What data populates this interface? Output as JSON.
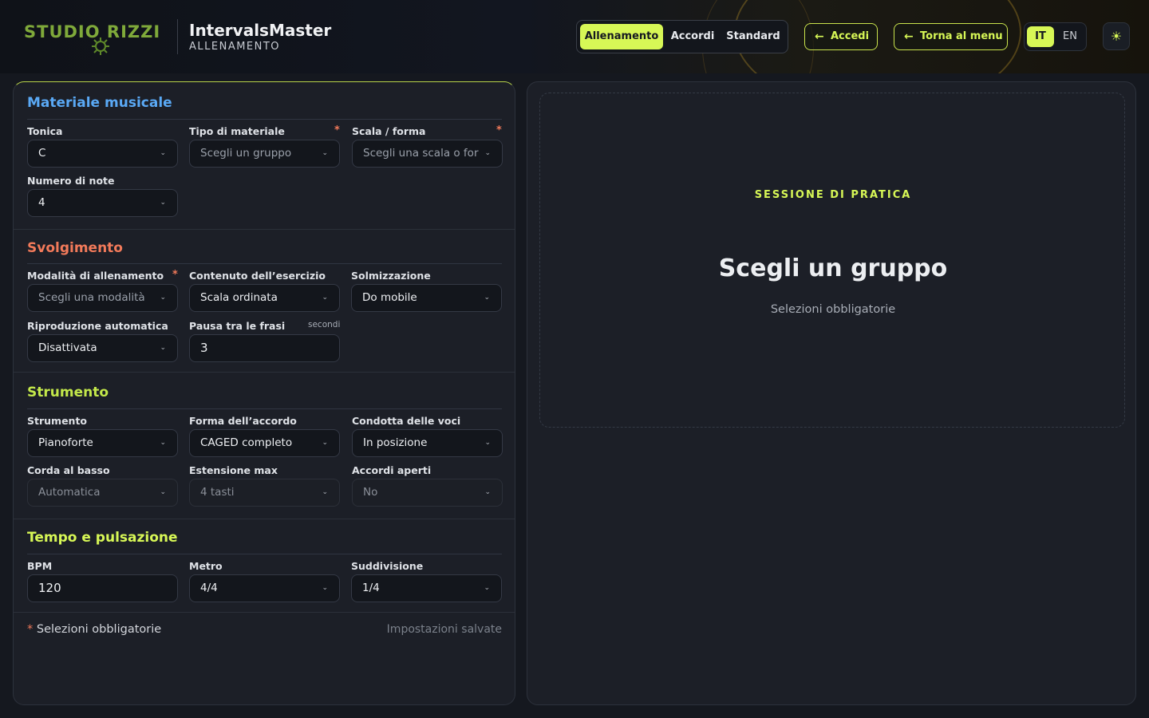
{
  "header": {
    "logo": "STUDIO RIZZI",
    "app_title": "IntervalsMaster",
    "app_subtitle": "ALLENAMENTO",
    "tabs": [
      {
        "label": "Allenamento",
        "active": true
      },
      {
        "label": "Accordi",
        "active": false
      },
      {
        "label": "Standard",
        "active": false
      }
    ],
    "login_label": "Accedi",
    "back_label": "Torna al menu",
    "languages": [
      {
        "label": "IT",
        "active": true
      },
      {
        "label": "EN",
        "active": false
      }
    ],
    "theme_icon": "sun-icon",
    "accent_color": "#d7f756"
  },
  "sections": {
    "materiale": {
      "title": "Materiale musicale",
      "color": "#5aa9f5",
      "tonica": {
        "label": "Tonica",
        "value": "C"
      },
      "tipo": {
        "label": "Tipo di materiale",
        "placeholder": "Scegli un gruppo",
        "required": true
      },
      "scala": {
        "label": "Scala / forma",
        "placeholder": "Scegli una scala o for",
        "required": true
      },
      "numero": {
        "label": "Numero di note",
        "value": "4"
      }
    },
    "svolgimento": {
      "title": "Svolgimento",
      "color": "#f27a5a",
      "modalita": {
        "label": "Modalità di allenamento",
        "placeholder": "Scegli una modalità",
        "required": true
      },
      "contenuto": {
        "label": "Contenuto dell’esercizio",
        "value": "Scala ordinata"
      },
      "solmizzazione": {
        "label": "Solmizzazione",
        "value": "Do mobile"
      },
      "riproduzione": {
        "label": "Riproduzione automatica",
        "value": "Disattivata"
      },
      "pausa": {
        "label": "Pausa tra le frasi",
        "unit": "secondi",
        "value": "3"
      }
    },
    "strumento": {
      "title": "Strumento",
      "color": "#c3e84a",
      "strumento": {
        "label": "Strumento",
        "value": "Pianoforte"
      },
      "forma": {
        "label": "Forma dell’accordo",
        "value": "CAGED completo"
      },
      "condotta": {
        "label": "Condotta delle voci",
        "value": "In posizione"
      },
      "corda": {
        "label": "Corda al basso",
        "value": "Automatica"
      },
      "estensione": {
        "label": "Estensione max",
        "value": "4 tasti"
      },
      "aperti": {
        "label": "Accordi aperti",
        "value": "No"
      }
    },
    "tempo": {
      "title": "Tempo e pulsazione",
      "color": "#d7f756",
      "bpm": {
        "label": "BPM",
        "value": "120"
      },
      "metro": {
        "label": "Metro",
        "value": "4/4"
      },
      "suddivisione": {
        "label": "Suddivisione",
        "value": "1/4"
      }
    }
  },
  "footer": {
    "required_note": "Selezioni obbligatorie",
    "saved_note": "Impostazioni salvate"
  },
  "practice": {
    "label": "SESSIONE DI PRATICA",
    "title": "Scegli un gruppo",
    "subtitle": "Selezioni obbligatorie"
  }
}
